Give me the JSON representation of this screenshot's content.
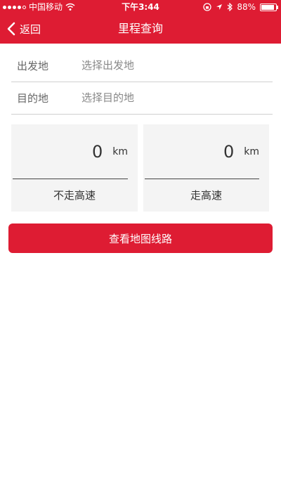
{
  "status_bar": {
    "carrier": "中国移动",
    "time": "下午3:44",
    "battery": "88%",
    "battery_level": 0.88
  },
  "nav": {
    "back_label": "返回",
    "title": "里程查询"
  },
  "form": {
    "origin": {
      "label": "出发地",
      "placeholder": "选择出发地",
      "value": ""
    },
    "destination": {
      "label": "目的地",
      "placeholder": "选择目的地",
      "value": ""
    }
  },
  "results": [
    {
      "value": "0",
      "unit": "km",
      "mode": "不走高速"
    },
    {
      "value": "0",
      "unit": "km",
      "mode": "走高速"
    }
  ],
  "action": {
    "label": "查看地图线路"
  },
  "colors": {
    "primary": "#de1c33",
    "card_bg": "#f4f4f4"
  }
}
